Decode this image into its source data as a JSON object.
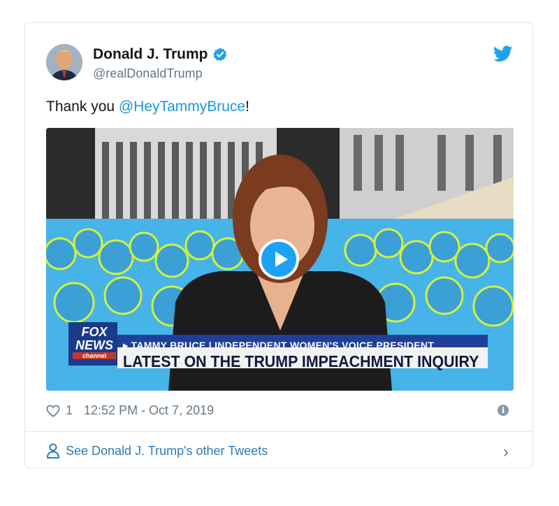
{
  "tweet": {
    "author_name": "Donald J. Trump",
    "author_handle": "@realDonaldTrump",
    "text_prefix": "Thank you ",
    "mention": "@HeyTammyBruce",
    "text_suffix": "!",
    "like_count": "1",
    "timestamp": "12:52 PM - Oct 7, 2019",
    "see_more": "See Donald J. Trump's other Tweets"
  },
  "video": {
    "logo_line1": "FOX",
    "logo_line2": "NEWS",
    "logo_line3": "channel",
    "chyron_top": "▸ TAMMY BRUCE | INDEPENDENT WOMEN'S VOICE PRESIDENT",
    "chyron_main": "LATEST ON THE TRUMP IMPEACHMENT INQUIRY"
  },
  "icons": {
    "verified": "verified-badge-icon",
    "bird": "twitter-bird-icon",
    "play": "play-icon",
    "heart": "heart-icon",
    "info": "info-icon",
    "person": "person-icon",
    "chevron": "chevron-right-icon"
  },
  "colors": {
    "accent": "#1da1f2",
    "link": "#2b7bb9",
    "muted": "#657786"
  }
}
